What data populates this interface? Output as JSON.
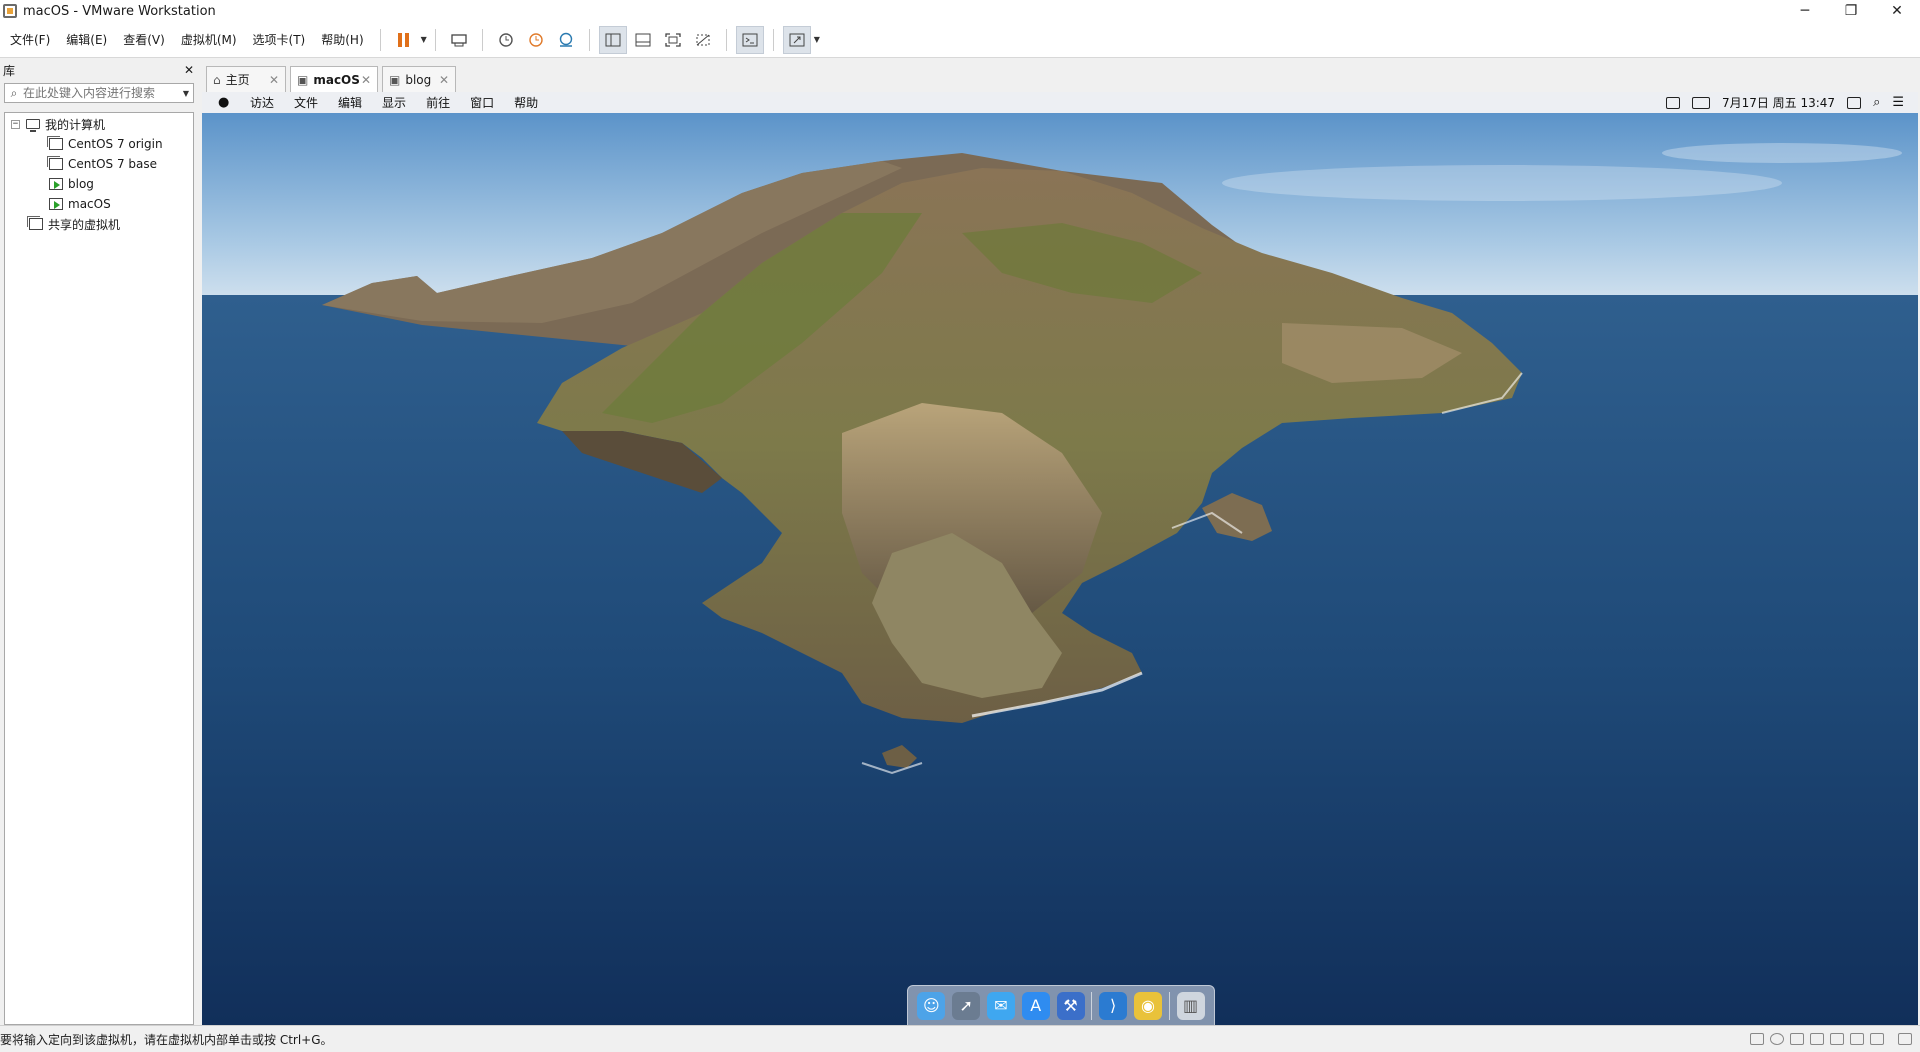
{
  "window": {
    "title": "macOS - VMware Workstation",
    "minimize": "─",
    "restore": "❐",
    "close": "✕"
  },
  "menu": {
    "file": "文件(F)",
    "edit": "编辑(E)",
    "view": "查看(V)",
    "vm": "虚拟机(M)",
    "tabs": "选项卡(T)",
    "help": "帮助(H)"
  },
  "library": {
    "title": "库",
    "close": "✕",
    "search_placeholder": "在此处键入内容进行搜索",
    "tree": {
      "root": "我的计算机",
      "expander": "−",
      "vms": [
        "CentOS 7 origin",
        "CentOS 7 base",
        "blog",
        "macOS"
      ],
      "shared": "共享的虚拟机"
    }
  },
  "tabs": [
    {
      "label": "主页",
      "icon": "home-icon",
      "close": "✕"
    },
    {
      "label": "macOS",
      "icon": "vm-running-icon",
      "close": "✕",
      "active": true
    },
    {
      "label": "blog",
      "icon": "vm-running-icon",
      "close": "✕"
    }
  ],
  "guest": {
    "menubar": {
      "apple": "",
      "items": [
        "访达",
        "文件",
        "编辑",
        "显示",
        "前往",
        "窗口",
        "帮助"
      ],
      "datetime": "7月17日 周五  13:47"
    },
    "dock": [
      "finder-icon",
      "launchpad-icon",
      "messages-icon",
      "app-store-icon",
      "xcode-icon",
      "vscode-icon",
      "chrome-icon",
      "trash-icon"
    ]
  },
  "status": {
    "message": "要将输入定向到该虚拟机，请在虚拟机内部单击或按 Ctrl+G。"
  }
}
